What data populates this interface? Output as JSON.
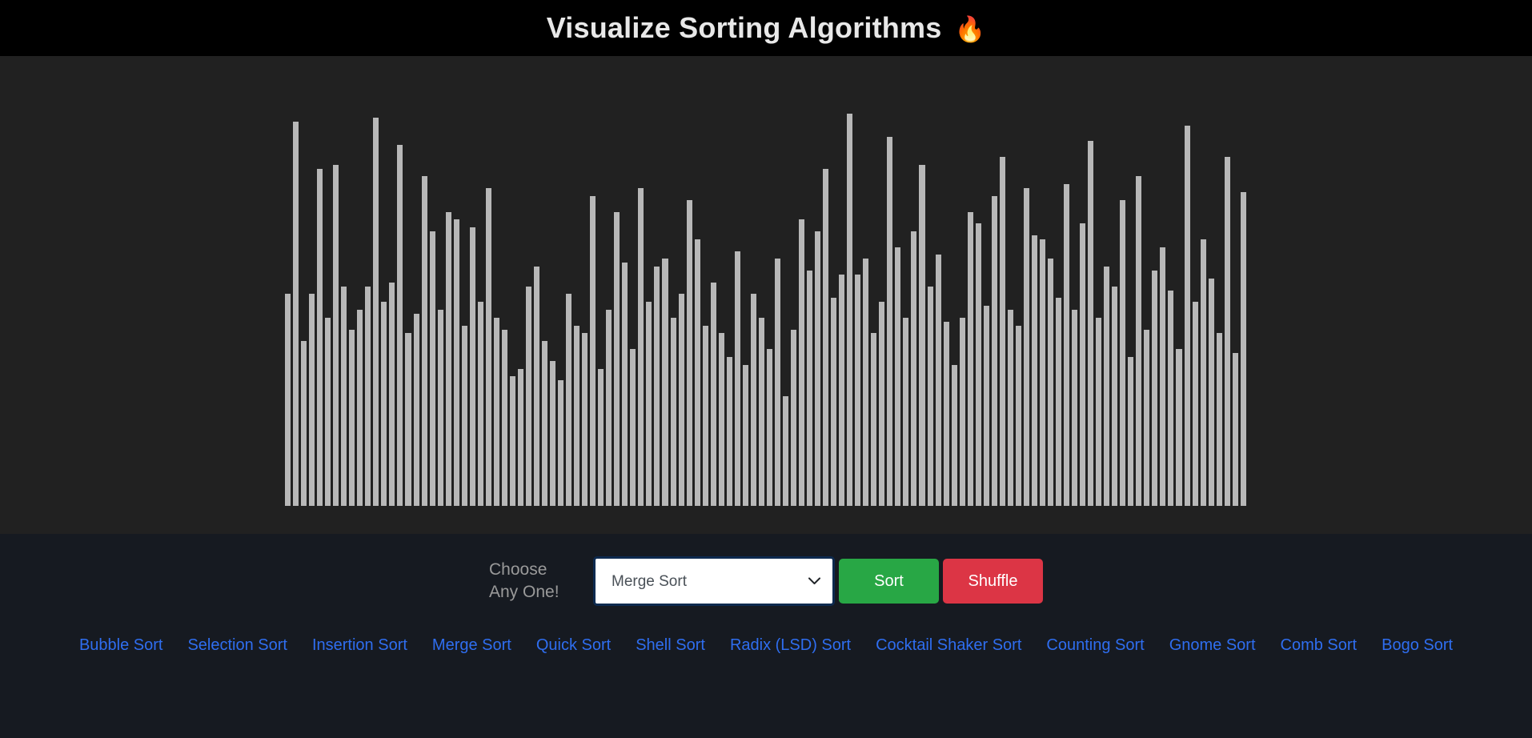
{
  "header": {
    "title": "Visualize Sorting Algorithms",
    "emoji": "🔥",
    "background_color": "#000000",
    "title_color": "#e8e8e8"
  },
  "visualizer": {
    "background_color": "#212121",
    "bar_color": "#b8b8b8",
    "bar_count": 120,
    "bar_values": [
      54,
      98,
      42,
      54,
      86,
      48,
      87,
      56,
      45,
      50,
      56,
      99,
      52,
      57,
      92,
      44,
      49,
      84,
      70,
      50,
      75,
      73,
      46,
      71,
      52,
      81,
      48,
      45,
      33,
      35,
      56,
      61,
      42,
      37,
      32,
      54,
      46,
      44,
      79,
      35,
      50,
      75,
      62,
      40,
      81,
      52,
      61,
      63,
      48,
      54,
      78,
      68,
      46,
      57,
      44,
      38,
      65,
      36,
      54,
      48,
      40,
      63,
      28,
      45,
      73,
      60,
      70,
      86,
      53,
      59,
      100,
      59,
      63,
      44,
      52,
      94,
      66,
      48,
      70,
      87,
      56,
      64,
      47,
      36,
      48,
      75,
      72,
      51,
      79,
      89,
      50,
      46,
      81,
      69,
      68,
      63,
      53,
      82,
      50,
      72,
      93,
      48,
      61,
      56,
      78,
      38,
      84,
      45,
      60,
      66,
      55,
      40,
      97,
      52,
      68,
      58,
      44,
      89,
      39,
      80
    ]
  },
  "controls": {
    "choose_label": "Choose\nAny One!",
    "choose_label_color": "#9a9a9a",
    "select": {
      "name": "algorithm-select",
      "selected": "Merge Sort",
      "chevron_icon": "chevron-down-icon",
      "border_color": "#0d2a4f",
      "options": [
        "Bubble Sort",
        "Selection Sort",
        "Insertion Sort",
        "Merge Sort",
        "Quick Sort",
        "Shell Sort",
        "Radix (LSD) Sort",
        "Cocktail Shaker Sort",
        "Counting Sort",
        "Gnome Sort",
        "Comb Sort",
        "Bogo Sort"
      ]
    },
    "sort_button": {
      "label": "Sort",
      "color": "#28a745"
    },
    "shuffle_button": {
      "label": "Shuffle",
      "color": "#dc3545"
    }
  },
  "algorithm_links": {
    "link_color": "#2f6ef0",
    "items": [
      {
        "label": "Bubble Sort"
      },
      {
        "label": "Selection Sort"
      },
      {
        "label": "Insertion Sort"
      },
      {
        "label": "Merge Sort"
      },
      {
        "label": "Quick Sort"
      },
      {
        "label": "Shell Sort"
      },
      {
        "label": "Radix (LSD) Sort"
      },
      {
        "label": "Cocktail Shaker Sort"
      },
      {
        "label": "Counting Sort"
      },
      {
        "label": "Gnome Sort"
      },
      {
        "label": "Comb Sort"
      },
      {
        "label": "Bogo Sort"
      }
    ]
  },
  "footer": {
    "background_color": "#161a21"
  }
}
